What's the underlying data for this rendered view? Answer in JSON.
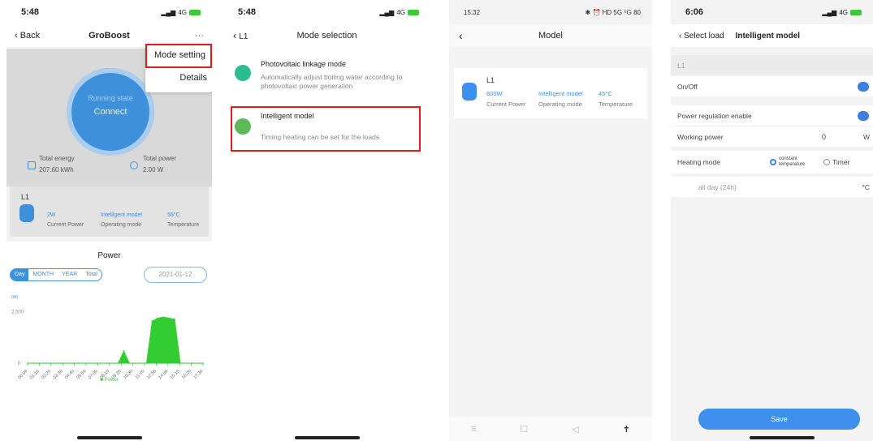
{
  "colors": {
    "accent": "#3f90db",
    "highlight": "#e21b1b",
    "chart_green": "#33cc33",
    "mode_icon_a": "#2bbd8f",
    "mode_icon_b": "#5fb85a"
  },
  "screen1": {
    "status": {
      "time": "5:48",
      "network": "4G"
    },
    "nav": {
      "back": "‹ Back",
      "title": "GroBoost",
      "more": "···"
    },
    "menu": {
      "items": [
        "Mode setting",
        "Details"
      ]
    },
    "bubble": {
      "status_label": "Running state",
      "status_value": "Connect"
    },
    "energy": {
      "total_energy_label": "Total energy",
      "total_energy_value": "207.60 kWh",
      "total_power_label": "Total power",
      "total_power_value": "2.00 W"
    },
    "load": {
      "name": "L1",
      "power": "2W",
      "power_label": "Current Power",
      "mode": "Intelligent model",
      "mode_label": "Operating mode",
      "temp": "56°C",
      "temp_label": "Temperature"
    },
    "power": {
      "title": "Power",
      "tabs": [
        "Day",
        "MONTH",
        "YEAR",
        "Total"
      ],
      "date": "2021-01-12",
      "legend": "Power"
    }
  },
  "chart_data": {
    "type": "area",
    "title": "Power",
    "ylabel": "(W)",
    "ylim": [
      0,
      3000
    ],
    "yticks": [
      "2,500",
      "0"
    ],
    "x_ticks": [
      "00:00",
      "01:10",
      "02:20",
      "03:30",
      "04:40",
      "05:50",
      "07:00",
      "08:10",
      "09:20",
      "10:30",
      "11:40",
      "12:50",
      "14:00",
      "15:10",
      "16:20",
      "17:30"
    ],
    "series": [
      {
        "name": "Power",
        "color": "#33cc33",
        "x": [
          0,
          1,
          2,
          3,
          4,
          5,
          6,
          7,
          8,
          9,
          10,
          11,
          12,
          13,
          14,
          15,
          16,
          17,
          18,
          19,
          20,
          21,
          22,
          23,
          24,
          25,
          26,
          27,
          28,
          29,
          30,
          31
        ],
        "values": [
          0,
          0,
          0,
          0,
          0,
          0,
          0,
          0,
          0,
          0,
          0,
          0,
          0,
          0,
          0,
          0,
          0,
          600,
          0,
          0,
          0,
          0,
          2050,
          2200,
          2250,
          2200,
          2150,
          0,
          0,
          0,
          0,
          0
        ]
      }
    ],
    "legend": "bottom-center",
    "grid": false
  },
  "screen2": {
    "status": {
      "time": "5:48",
      "network": "4G"
    },
    "nav": {
      "back": "L1",
      "title": "Mode selection"
    },
    "modes": [
      {
        "title": "Photovoltaic linkage mode",
        "desc": "Automatically adjust boiling water according to photovoltaic power generation"
      },
      {
        "title": "Intelligent model",
        "desc": "Timing heating can be set for the loads"
      }
    ]
  },
  "screen3": {
    "status": {
      "time": "15:32",
      "icons": "✱ ⏰ HD 5G ⁵G 80"
    },
    "nav": {
      "title": "Model"
    },
    "load": {
      "name": "L1",
      "power": "600W",
      "power_label": "Current Power",
      "mode": "Intelligent model",
      "mode_label": "Operating mode",
      "temp": "45°C",
      "temp_label": "Temperature"
    },
    "bottom": [
      "≡",
      "☐",
      "◁",
      "✝"
    ]
  },
  "screen4": {
    "status": {
      "time": "6:06",
      "network": "4G"
    },
    "nav": {
      "back": "Select load",
      "title": "Intelligent model"
    },
    "section": "L1",
    "onoff_label": "On/Off",
    "regulation_label": "Power regulation enable",
    "working_power_label": "Working power",
    "working_power_value": "0",
    "working_power_unit": "W",
    "heating_mode_label": "Heating mode",
    "option_constant": "constant temperature",
    "option_timer": "Timer",
    "all_day": "all day (24h)",
    "temp_unit": "°C",
    "save": "Save"
  }
}
